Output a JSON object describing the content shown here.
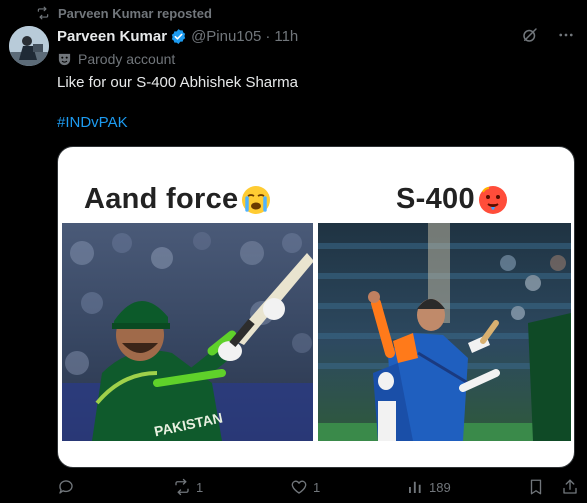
{
  "repost": {
    "text": "Parveen Kumar reposted",
    "icon": "repost-icon"
  },
  "author": {
    "name": "Parveen Kumar",
    "handle": "@Pinu105",
    "separator": "·",
    "time": "11h",
    "verified": true,
    "label": "Parody account"
  },
  "tweet": {
    "text": "Like for our S-400 Abhishek Sharma",
    "hashtag": "#INDvPAK"
  },
  "media": {
    "left_caption": "Aand force",
    "left_emoji": "crying-face",
    "right_caption": "S-400",
    "right_emoji": "hot-face"
  },
  "actions": {
    "reply_count": "",
    "repost_count": "1",
    "like_count": "1",
    "views_count": "189"
  },
  "colors": {
    "accent": "#1d9bf0",
    "muted": "#71767b",
    "text": "#e7e9ea",
    "bg": "#000000"
  }
}
